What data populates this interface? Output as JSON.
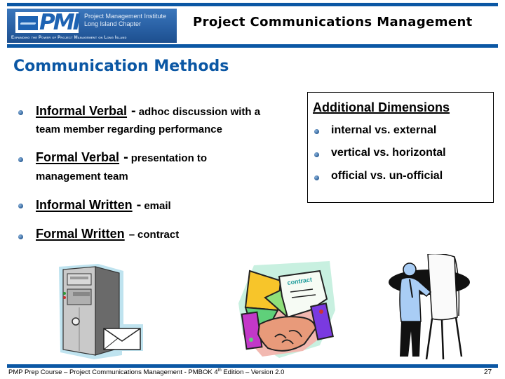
{
  "header": {
    "logo": {
      "acronym": "PMI",
      "institute_line1": "Project Management Institute",
      "institute_line2": "Long Island Chapter",
      "tagline": "Expanding the Power of Project Management on Long Island"
    },
    "title": "Project Communications Management"
  },
  "slide": {
    "title": "Communication Methods",
    "methods": [
      {
        "term": "Informal Verbal",
        "separator": "-",
        "desc_line1": "adhoc discussion with a",
        "desc_line2": "team member regarding performance"
      },
      {
        "term": "Formal Verbal",
        "separator": "-",
        "desc_line1": "presentation to",
        "desc_line2": "management team"
      },
      {
        "term": "Informal Written",
        "separator": "-",
        "desc_line1": "email"
      },
      {
        "term": "Formal Written",
        "separator": "–",
        "desc_line1": "contract"
      }
    ],
    "dimensions": {
      "title": "Additional Dimensions",
      "items": [
        "internal vs. external",
        "vertical vs. horizontal",
        "official vs. un-official"
      ]
    },
    "clipart": [
      "computer-email-icon",
      "contract-handshake-icon",
      "presenter-flipchart-icon"
    ]
  },
  "footer": {
    "text_before_sup": "PMP Prep Course – Project Communications Management - PMBOK 4",
    "sup": "th",
    "text_after_sup": " Edition – Version 2.0",
    "page_number": "27"
  },
  "colors": {
    "accent": "#0b57a4",
    "text": "#000000"
  }
}
